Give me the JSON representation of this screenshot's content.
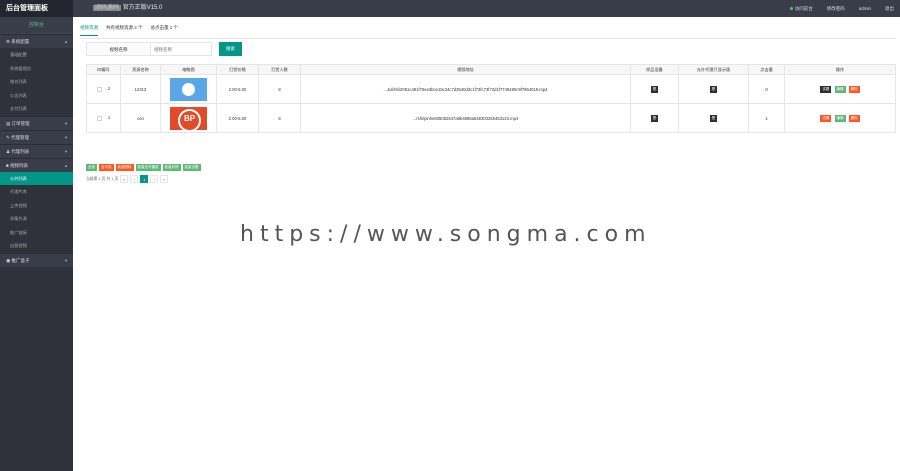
{
  "header": {
    "title": "后台管理面板",
    "subtitle_highlight": "颂码源码",
    "subtitle": "官方正版V15.0",
    "right_items": [
      "访问前台",
      "修改密码",
      "admin",
      "退出"
    ]
  },
  "sidebar": {
    "head": "控制台",
    "groups": [
      {
        "label": "系统配置",
        "items": [
          "基础配置",
          "系统管理员",
          "域名列表",
          "公告列表",
          "支付列表"
        ]
      },
      {
        "label": "订单管理",
        "items": []
      },
      {
        "label": "代理管理",
        "items": []
      },
      {
        "label": "代理列表",
        "items": []
      },
      {
        "label": "视频列表",
        "items": [
          "公共列表",
          "代理片库",
          "上传视频",
          "采集片源",
          "推广链接",
          "自营视频"
        ]
      },
      {
        "label": "推广盒子",
        "items": []
      }
    ],
    "active_item": "公共列表"
  },
  "tabs": [
    "视频资源",
    "共有视频资源 2 个",
    "总点击量 1 个"
  ],
  "search": {
    "label": "视频名称",
    "placeholder": "视频名称",
    "button": "搜索"
  },
  "table": {
    "headers": [
      "ID编号",
      "资源名称",
      "缩略图",
      "打赏价格",
      "打赏人数",
      "视频地址",
      "样品设备",
      "允许代理只显示版",
      "点击量",
      "操作"
    ],
    "rows": [
      {
        "id": "2",
        "name": "12313",
        "price": "2.00-5.00",
        "count": "8",
        "url": "...Jul/shi/2061c491f76ee3bce15c34c7d3540d3c1f73fc73f73d1f7749480c9f7964018.mp4",
        "clicks": "0",
        "ops": [
          "试看",
          "编辑",
          "删除"
        ]
      },
      {
        "id": "1",
        "name": "ceo",
        "price": "2.00-5.00",
        "count": "8",
        "url": "...rshi/pinhe605052647a9b4886a548303255463123.mp4",
        "clicks": "1",
        "ops": [
          "试看",
          "编辑",
          "删除"
        ]
      }
    ],
    "square_label": "是"
  },
  "bulk_actions": [
    "全选",
    "全不选",
    "批量删除",
    "批量允许播放",
    "批量封停",
    "批量试看"
  ],
  "pager": {
    "info": "当前第 1 页 共 1 页",
    "prev2": "«",
    "prev": "‹",
    "current": "1",
    "next": "›",
    "next2": "»"
  },
  "watermark": "https://www.songma.com",
  "colors": {
    "accent": "#009688",
    "sidebar": "#2f323b",
    "topbar": "#393d49"
  }
}
